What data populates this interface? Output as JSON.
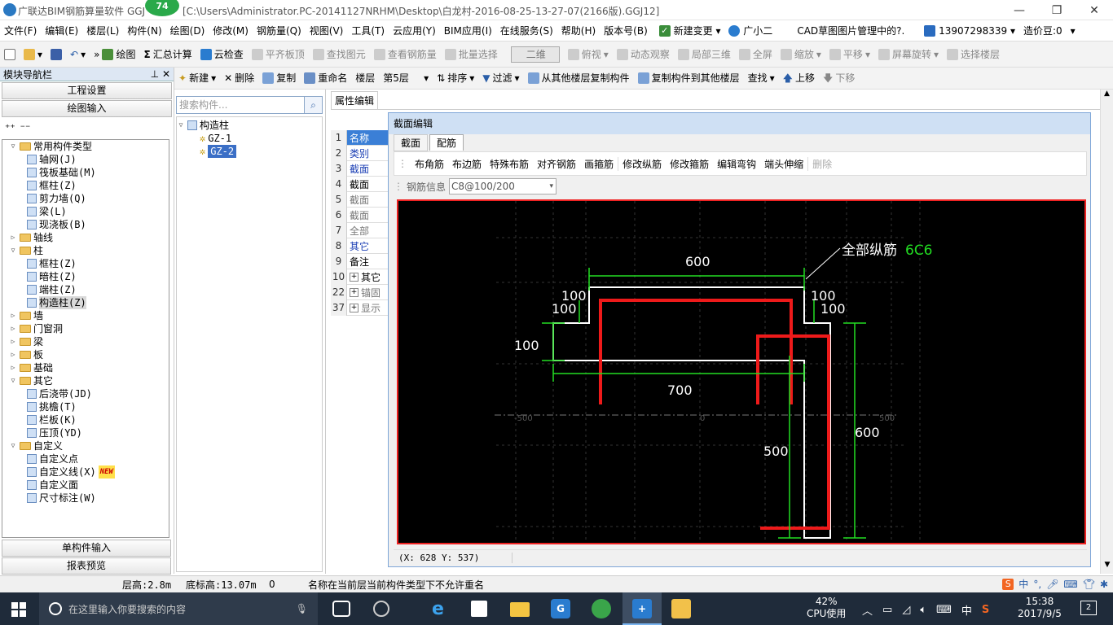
{
  "title": {
    "app": "广联达BIM钢筋算量软件 GGJ",
    "badge": "74",
    "path": "[C:\\Users\\Administrator.PC-20141127NRHM\\Desktop\\白龙村-2016-08-25-13-27-07(2166版).GGJ12]"
  },
  "menu": [
    "文件(F)",
    "编辑(E)",
    "楼层(L)",
    "构件(N)",
    "绘图(D)",
    "修改(M)",
    "钢筋量(Q)",
    "视图(V)",
    "工具(T)",
    "云应用(Y)",
    "BIM应用(I)",
    "在线服务(S)",
    "帮助(H)",
    "版本号(B)"
  ],
  "menu_right": {
    "new_change": "新建变更",
    "guangxiaoer": "广小二",
    "cad": "CAD草图图片管理中的?.",
    "phone": "13907298339",
    "price_bean": "造价豆:0"
  },
  "toolbar": {
    "draw": "绘图",
    "sum": "汇总计算",
    "cloud_check": "云检查",
    "flat_top": "平齐板顶",
    "find_element": "查找图元",
    "view_rebar": "查看钢筋量",
    "batch_select": "批量选择",
    "view_mode": "二维",
    "top_view": "俯视",
    "dynamic_view": "动态观察",
    "local_3d": "局部三维",
    "full_screen": "全屏",
    "zoom": "缩放",
    "pan": "平移",
    "rotate": "屏幕旋转",
    "select_floor": "选择楼层"
  },
  "toolbar2": {
    "new": "新建",
    "delete": "删除",
    "copy": "复制",
    "rename": "重命名",
    "floor_label": "楼层",
    "floor_value": "第5层",
    "sort": "排序",
    "filter": "过滤",
    "copy_from": "从其他楼层复制构件",
    "copy_to": "复制构件到其他楼层",
    "find": "查找",
    "up": "上移",
    "down": "下移"
  },
  "left": {
    "header": "模块导航栏",
    "btn_project": "工程设置",
    "btn_draw": "绘图输入",
    "btn_single": "单构件输入",
    "btn_report": "报表预览",
    "tree": [
      {
        "level": 0,
        "label": "常用构件类型",
        "type": "folder",
        "open": true
      },
      {
        "level": 1,
        "label": "轴网(J)",
        "type": "item"
      },
      {
        "level": 1,
        "label": "筏板基础(M)",
        "type": "item"
      },
      {
        "level": 1,
        "label": "框柱(Z)",
        "type": "item"
      },
      {
        "level": 1,
        "label": "剪力墙(Q)",
        "type": "item"
      },
      {
        "level": 1,
        "label": "梁(L)",
        "type": "item"
      },
      {
        "level": 1,
        "label": "现浇板(B)",
        "type": "item"
      },
      {
        "level": 0,
        "label": "轴线",
        "type": "folder",
        "open": false
      },
      {
        "level": 0,
        "label": "柱",
        "type": "folder",
        "open": true
      },
      {
        "level": 1,
        "label": "框柱(Z)",
        "type": "item"
      },
      {
        "level": 1,
        "label": "暗柱(Z)",
        "type": "item"
      },
      {
        "level": 1,
        "label": "端柱(Z)",
        "type": "item"
      },
      {
        "level": 1,
        "label": "构造柱(Z)",
        "type": "item",
        "selected": true
      },
      {
        "level": 0,
        "label": "墙",
        "type": "folder",
        "open": false
      },
      {
        "level": 0,
        "label": "门窗洞",
        "type": "folder",
        "open": false
      },
      {
        "level": 0,
        "label": "梁",
        "type": "folder",
        "open": false
      },
      {
        "level": 0,
        "label": "板",
        "type": "folder",
        "open": false
      },
      {
        "level": 0,
        "label": "基础",
        "type": "folder",
        "open": false
      },
      {
        "level": 0,
        "label": "其它",
        "type": "folder",
        "open": true
      },
      {
        "level": 1,
        "label": "后浇带(JD)",
        "type": "item"
      },
      {
        "level": 1,
        "label": "挑檐(T)",
        "type": "item"
      },
      {
        "level": 1,
        "label": "栏板(K)",
        "type": "item"
      },
      {
        "level": 1,
        "label": "压顶(YD)",
        "type": "item"
      },
      {
        "level": 0,
        "label": "自定义",
        "type": "folder",
        "open": true
      },
      {
        "level": 1,
        "label": "自定义点",
        "type": "item"
      },
      {
        "level": 1,
        "label": "自定义线(X)",
        "type": "item",
        "badge": "NEW"
      },
      {
        "level": 1,
        "label": "自定义面",
        "type": "item"
      },
      {
        "level": 1,
        "label": "尺寸标注(W)",
        "type": "item"
      }
    ]
  },
  "components": {
    "search_placeholder": "搜索构件...",
    "root": "构造柱",
    "items": [
      "GZ-1",
      "GZ-2"
    ],
    "selected": "GZ-2"
  },
  "props": {
    "tab": "属性编辑",
    "rows": [
      {
        "n": "1",
        "v": "名称"
      },
      {
        "n": "2",
        "v": "类别"
      },
      {
        "n": "3",
        "v": "截面"
      },
      {
        "n": "4",
        "v": "截面"
      },
      {
        "n": "5",
        "v": "截面"
      },
      {
        "n": "6",
        "v": "截面"
      },
      {
        "n": "7",
        "v": "全部"
      },
      {
        "n": "8",
        "v": "其它"
      },
      {
        "n": "9",
        "v": "备注"
      },
      {
        "n": "10",
        "v": "其它"
      },
      {
        "n": "22",
        "v": "锚固"
      },
      {
        "n": "37",
        "v": "显示"
      }
    ]
  },
  "dialog": {
    "title": "截面编辑",
    "tab_section": "截面",
    "tab_rebar": "配筋",
    "actions": [
      "布角筋",
      "布边筋",
      "特殊布筋",
      "对齐钢筋",
      "画箍筋",
      "修改纵筋",
      "修改箍筋",
      "编辑弯钩",
      "端头伸缩",
      "删除"
    ],
    "rebar_info_label": "钢筋信息",
    "rebar_info_value": "C8@100/200",
    "coord": "(X: 628 Y: 537)",
    "drawing": {
      "label_all": "全部纵筋",
      "label_spec": "6C6",
      "dims": [
        "600",
        "100",
        "100",
        "100",
        "100",
        "100",
        "700",
        "500",
        "600"
      ],
      "axis_ticks": [
        "-500",
        "0",
        "500"
      ]
    }
  },
  "status": {
    "floor_height": "层高:2.8m",
    "base_elev": "底标高:13.07m",
    "zero": "0",
    "msg": "名称在当前层当前构件类型下不允许重名"
  },
  "taskbar": {
    "search": "在这里输入你要搜索的内容",
    "cpu_pct": "42%",
    "cpu_label": "CPU使用",
    "ime": "中",
    "time": "15:38",
    "date": "2017/9/5",
    "notif": "2"
  }
}
